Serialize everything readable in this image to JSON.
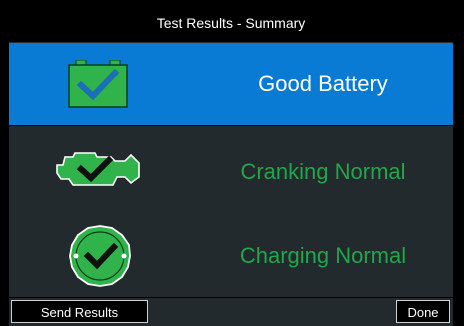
{
  "header": {
    "title": "Test Results - Summary"
  },
  "results": [
    {
      "label": "Good Battery",
      "icon": "battery-check-icon",
      "selected": true,
      "label_color": "#ffffff"
    },
    {
      "label": "Cranking Normal",
      "icon": "engine-check-icon",
      "selected": false,
      "label_color": "#21a64a"
    },
    {
      "label": "Charging Normal",
      "icon": "alternator-check-icon",
      "selected": false,
      "label_color": "#21a64a"
    }
  ],
  "footer": {
    "send_label": "Send Results",
    "done_label": "Done"
  },
  "colors": {
    "selected_row": "#0a7bd4",
    "panel": "#222a2e",
    "status_green": "#21a64a",
    "icon_green": "#2fb34a",
    "check_blue": "#1b6fb8"
  }
}
